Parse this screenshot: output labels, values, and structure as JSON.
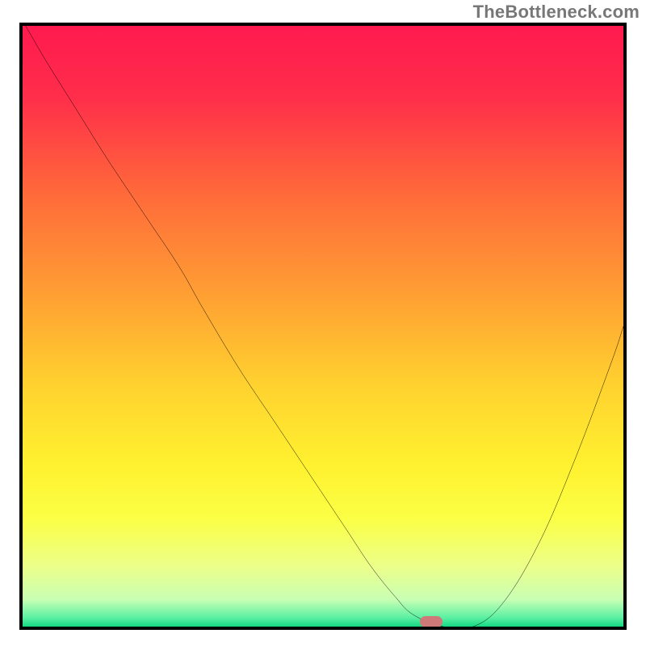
{
  "watermark": "TheBottleneck.com",
  "colors": {
    "frame": "#000000",
    "curve": "#000000",
    "marker": "#cf7a79",
    "gradient_stops": [
      {
        "offset": 0.0,
        "color": "#ff1a4f"
      },
      {
        "offset": 0.12,
        "color": "#ff2e4a"
      },
      {
        "offset": 0.28,
        "color": "#ff6a3a"
      },
      {
        "offset": 0.45,
        "color": "#ffa033"
      },
      {
        "offset": 0.6,
        "color": "#ffd22f"
      },
      {
        "offset": 0.73,
        "color": "#fff12f"
      },
      {
        "offset": 0.82,
        "color": "#fbff45"
      },
      {
        "offset": 0.9,
        "color": "#ecff8a"
      },
      {
        "offset": 0.955,
        "color": "#c8ffb4"
      },
      {
        "offset": 0.985,
        "color": "#5cf0a3"
      },
      {
        "offset": 1.0,
        "color": "#14d884"
      }
    ]
  },
  "chart_data": {
    "type": "line",
    "title": "",
    "xlabel": "",
    "ylabel": "",
    "xlim": [
      0,
      100
    ],
    "ylim": [
      0,
      100
    ],
    "series": [
      {
        "name": "bottleneck-curve",
        "x": [
          0.5,
          4,
          9,
          14,
          20,
          26,
          30,
          36,
          42,
          48,
          54,
          58,
          62,
          65,
          70,
          75,
          80,
          86,
          92,
          98,
          100
        ],
        "y": [
          100,
          94,
          86,
          78,
          69,
          60,
          53,
          43,
          34,
          25,
          16,
          10,
          5,
          2,
          0,
          0,
          4,
          14,
          28,
          44,
          50
        ]
      }
    ],
    "marker": {
      "x": 68,
      "y": 0.8
    }
  }
}
